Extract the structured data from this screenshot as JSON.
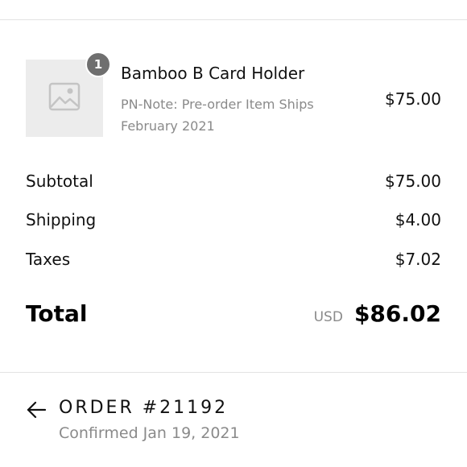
{
  "cart": {
    "item": {
      "quantity": "1",
      "title": "Bamboo B Card Holder",
      "note": "PN-Note: Pre-order Item Ships February 2021",
      "price": "$75.00",
      "image_icon": "image-placeholder-icon"
    }
  },
  "summary": {
    "subtotal_label": "Subtotal",
    "subtotal_value": "$75.00",
    "shipping_label": "Shipping",
    "shipping_value": "$4.00",
    "taxes_label": "Taxes",
    "taxes_value": "$7.02",
    "total_label": "Total",
    "currency": "USD",
    "total_value": "$86.02"
  },
  "order": {
    "back_icon": "arrow-left-icon",
    "number": "ORDER #21192",
    "status": "Confirmed Jan 19, 2021"
  },
  "colors": {
    "text_primary": "#111111",
    "text_secondary": "#8a8a8a",
    "badge": "#6f6f6f",
    "thumb_bg": "#ececec",
    "divider": "#e3e3e3"
  }
}
